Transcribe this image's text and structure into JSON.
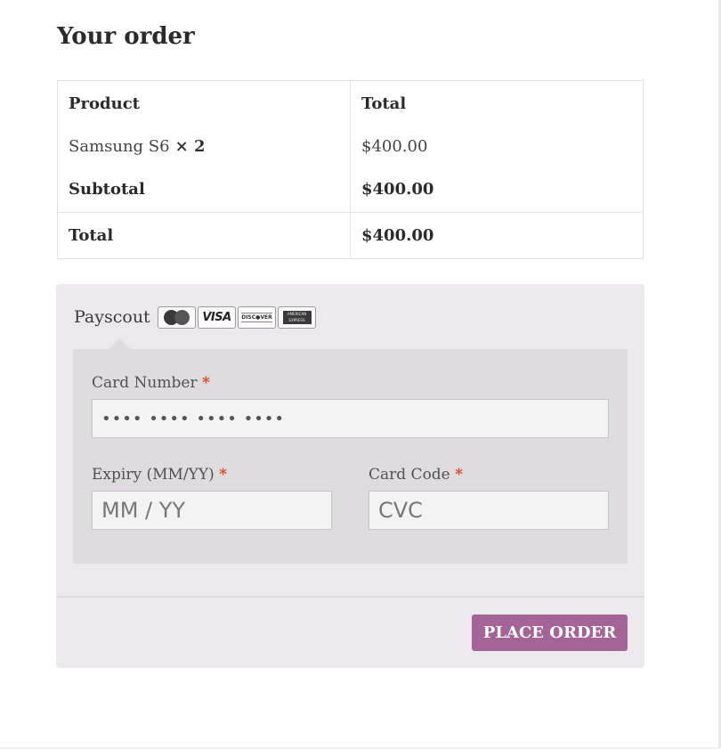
{
  "heading": "Your order",
  "order_table": {
    "headers": [
      "Product",
      "Total"
    ],
    "items": [
      {
        "product": "Samsung S6",
        "qty": "× 2",
        "total": "$400.00"
      }
    ],
    "subtotal": {
      "label": "Subtotal",
      "value": "$400.00"
    },
    "total": {
      "label": "Total",
      "value": "$400.00"
    }
  },
  "payment": {
    "method_label": "Payscout",
    "card_logos": [
      "MasterCard",
      "VISA",
      "DISCOVER",
      "AMERICAN EXPRESS"
    ],
    "card_number": {
      "label": "Card Number",
      "required": "*",
      "placeholder": "•••• •••• •••• ••••"
    },
    "expiry": {
      "label": "Expiry (MM/YY)",
      "required": "*",
      "placeholder": "MM / YY"
    },
    "card_code": {
      "label": "Card Code",
      "required": "*",
      "placeholder": "CVC"
    }
  },
  "place_order_label": "PLACE ORDER",
  "colors": {
    "button_bg": "#a46497",
    "required_marker": "#e2401c",
    "payment_panel": "#ebe9eb",
    "payment_box": "#dedcde"
  }
}
